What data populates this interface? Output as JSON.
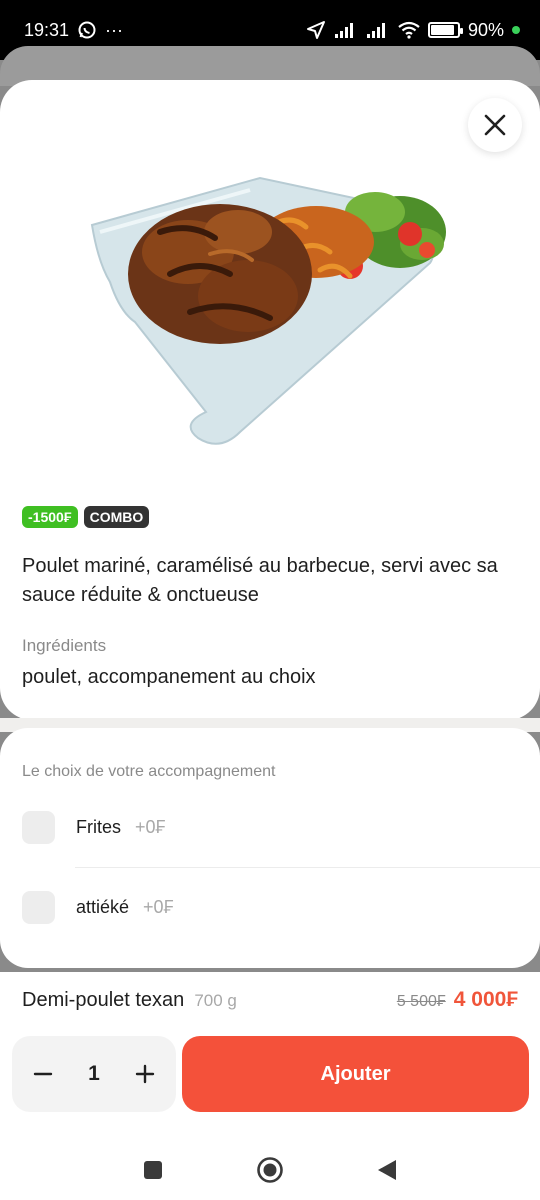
{
  "status_bar": {
    "time": "19:31",
    "overflow": "···",
    "battery_percent": "90%",
    "battery_level": 0.9,
    "icons": [
      "whatsapp-icon",
      "location-arrow-icon",
      "signal-icon",
      "signal-icon",
      "wifi-icon",
      "battery-icon"
    ]
  },
  "product": {
    "image_alt": "grilled chicken with fries and salad",
    "badges": {
      "discount": "-1500₣",
      "combo": "COMBO"
    },
    "description": "Poulet mariné, caramélisé au barbecue, servi avec sa sauce réduite & onctueuse",
    "ingredients_title": "Ingrédients",
    "ingredients": "poulet, accompanement au choix"
  },
  "options": {
    "title": "Le choix de votre accompagnement",
    "items": [
      {
        "name": "Frites",
        "price": "+0₣",
        "checked": false
      },
      {
        "name": "attiéké",
        "price": "+0₣",
        "checked": false
      }
    ]
  },
  "summary": {
    "name": "Demi-poulet texan",
    "weight": "700 g",
    "old_price": "5 500₣",
    "new_price": "4 000₣"
  },
  "cart": {
    "quantity": "1",
    "add_label": "Ajouter"
  },
  "colors": {
    "accent": "#f4513a",
    "discount_badge": "#3fbf22",
    "combo_badge": "#333333"
  }
}
